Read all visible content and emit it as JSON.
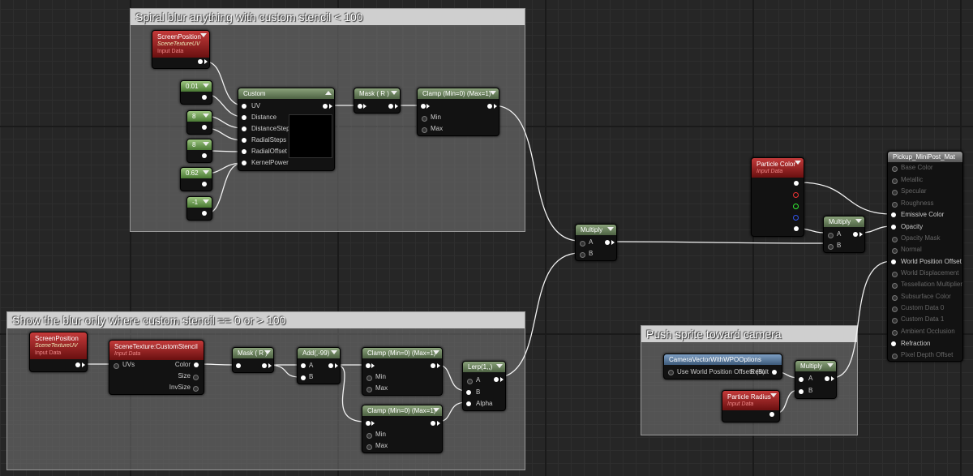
{
  "comments": {
    "spiral": "Spiral blur anything with custom stencil < 100",
    "show": "Show the blur only where custom stencil == 0 or > 100",
    "push": "Push sprite toward camera"
  },
  "nodes": {
    "screenpos1": {
      "title": "ScreenPosition",
      "sub": "SceneTextureUV",
      "sub2": "Input Data"
    },
    "const1": "0.01",
    "const2": "8",
    "const3": "8",
    "const4": "0.62",
    "const5": "-1",
    "custom": {
      "title": "Custom",
      "pins": [
        "UV",
        "Distance",
        "DistanceSteps",
        "RadialSteps",
        "RadialOffset",
        "KernelPower"
      ]
    },
    "mask1": "Mask ( R )",
    "clamp1": {
      "title": "Clamp (Min=0) (Max=1)",
      "min": "Min",
      "max": "Max"
    },
    "multiply1": {
      "title": "Multiply",
      "a": "A",
      "b": "B"
    },
    "particle_color": {
      "title": "Particle Color",
      "sub": "Input Data"
    },
    "multiply2": {
      "title": "Multiply",
      "a": "A",
      "b": "B"
    },
    "material": {
      "title": "Pickup_MiniPost_Mat",
      "pins": [
        "Base Color",
        "Metallic",
        "Specular",
        "Roughness",
        "Emissive Color",
        "Opacity",
        "Opacity Mask",
        "Normal",
        "World Position Offset",
        "World Displacement",
        "Tessellation Multiplier",
        "Subsurface Color",
        "Custom Data 0",
        "Custom Data 1",
        "Ambient Occlusion",
        "Refraction",
        "Pixel Depth Offset"
      ]
    },
    "screenpos2": {
      "title": "ScreenPosition",
      "sub": "SceneTextureUV",
      "sub2": "Input Data"
    },
    "stencil": {
      "title": "SceneTexture:CustomStencil",
      "sub": "Input Data",
      "uvs": "UVs",
      "color": "Color",
      "size": "Size",
      "invsize": "InvSize"
    },
    "mask2": "Mask ( R )",
    "add": {
      "title": "Add(,-99)",
      "a": "A",
      "b": "B"
    },
    "clamp2": {
      "title": "Clamp (Min=0) (Max=1)",
      "min": "Min",
      "max": "Max"
    },
    "clamp3": {
      "title": "Clamp (Min=0) (Max=1)",
      "min": "Min",
      "max": "Max"
    },
    "lerp": {
      "title": "Lerp(1,,)",
      "a": "A",
      "b": "B",
      "alpha": "Alpha"
    },
    "camvec": {
      "title": "CameraVectorWithWPOOptions",
      "pin": "Use World Position Offsets (B)",
      "result": "Result"
    },
    "multiply3": {
      "title": "Multiply",
      "a": "A",
      "b": "B"
    },
    "particle_radius": {
      "title": "Particle Radius",
      "sub": "Input Data"
    }
  },
  "colors": {
    "bg": "#262626",
    "header_green": "#4e6344",
    "header_red": "#6a1010",
    "header_blue": "#3d5a7a"
  }
}
